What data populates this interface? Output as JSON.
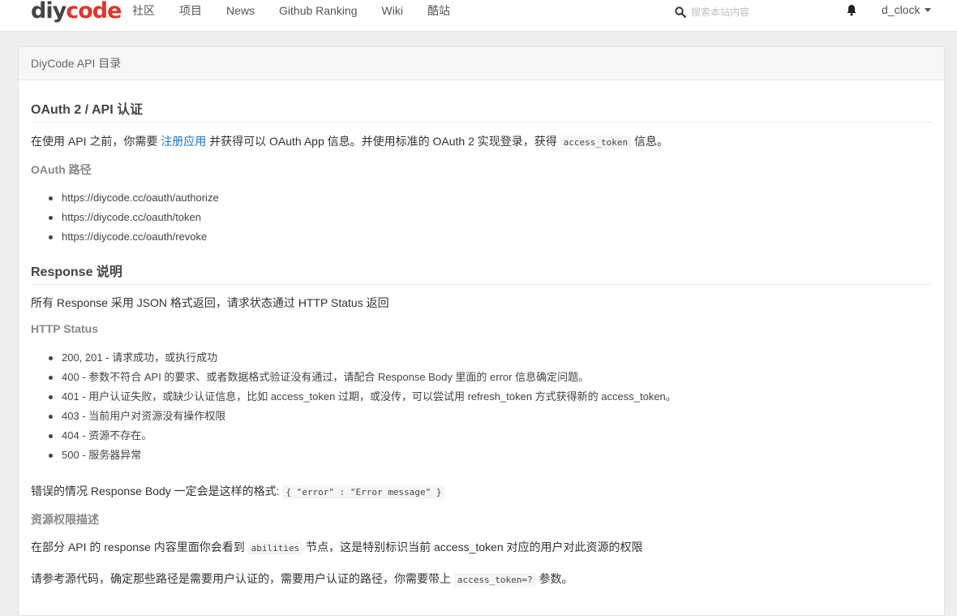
{
  "nav": {
    "logo_main": "diy",
    "logo_accent": "code",
    "links": [
      "社区",
      "项目",
      "News",
      "Github Ranking",
      "Wiki",
      "酷站"
    ],
    "search_placeholder": "搜索本站内容",
    "user": "d_clock",
    "icons": {
      "search": "search-icon",
      "bell": "bell-icon",
      "caret": "caret-down-icon"
    }
  },
  "panel": {
    "title": "DiyCode API 目录"
  },
  "content": {
    "oauth_heading": "OAuth 2 / API 认证",
    "oauth_intro_1": "在使用 API 之前，你需要 ",
    "oauth_intro_link": "注册应用",
    "oauth_intro_2": " 并获得可以 OAuth App 信息。并使用标准的 OAuth 2 实现登录，获得 ",
    "oauth_intro_code": "access_token",
    "oauth_intro_3": " 信息。",
    "oauth_paths_heading": "OAuth 路径",
    "oauth_paths": [
      "https://diycode.cc/oauth/authorize",
      "https://diycode.cc/oauth/token",
      "https://diycode.cc/oauth/revoke"
    ],
    "response_heading": "Response 说明",
    "response_intro": "所有 Response 采用 JSON 格式返回，请求状态通过 HTTP Status 返回",
    "http_status_heading": "HTTP Status",
    "statuses": [
      "200, 201 - 请求成功，或执行成功",
      "400 - 参数不符合 API 的要求、或者数据格式验证没有通过，请配合 Response Body 里面的 error 信息确定问题。",
      "401 - 用户认证失败，或缺少认证信息，比如 access_token 过期，或没传，可以尝试用 refresh_token 方式获得新的 access_token。",
      "403 - 当前用户对资源没有操作权限",
      "404 - 资源不存在。",
      "500 - 服务器异常"
    ],
    "error_format_text": "错误的情况 Response Body 一定会是这样的格式: ",
    "error_format_code": "{ \"error\" : \"Error message\" }",
    "permission_heading": "资源权限描述",
    "permission_text_1": "在部分 API 的 response 内容里面你会看到 ",
    "permission_code": "abilities",
    "permission_text_2": " 节点，这是特别标识当前 access_token 对应的用户对此资源的权限",
    "source_text_1": "请参考源代码，确定那些路径是需要用户认证的，需要用户认证的路径，你需要带上 ",
    "source_code": "access_token=?",
    "source_text_2": " 参数。"
  }
}
